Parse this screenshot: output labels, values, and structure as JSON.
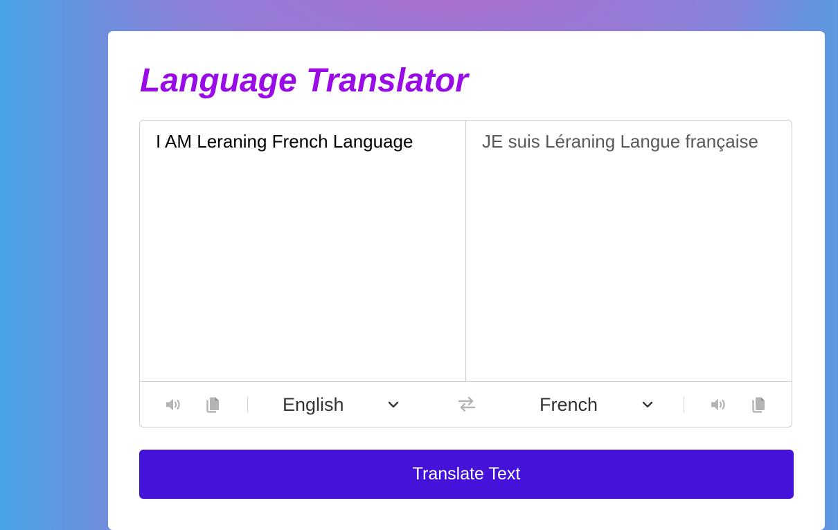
{
  "app": {
    "title": "Language Translator"
  },
  "input": {
    "from_text": "I AM Leraning French Language"
  },
  "output": {
    "to_text": "JE suis Léraning Langue française"
  },
  "controls": {
    "from_language": "English",
    "to_language": "French",
    "icons": [
      "volume-icon",
      "copy-icon",
      "exchange-icon",
      "chevron-down-icon"
    ]
  },
  "action": {
    "translate_label": "Translate Text"
  },
  "colors": {
    "title": "#9a0ce6",
    "button": "#4412d9",
    "icon": "#b4b4b4"
  }
}
